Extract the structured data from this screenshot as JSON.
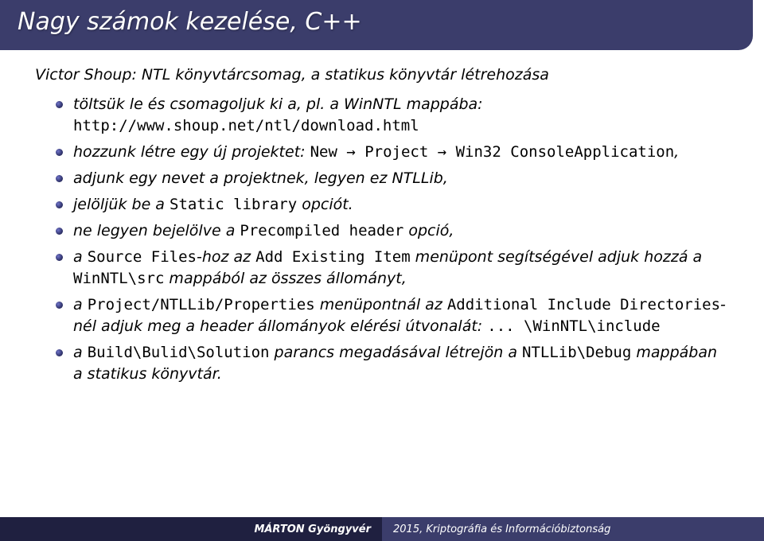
{
  "title": "Nagy számok kezelése, C++",
  "intro": "Victor Shoup: NTL könyvtárcsomag, a statikus könyvtár létrehozása",
  "items": {
    "b1_a": "töltsük le és csomagoljuk ki a, pl. a WinNTL mappába:",
    "b1_b": "http://www.shoup.net/ntl/download.html",
    "b2_a": "hozzunk létre egy új projektet: ",
    "b2_b": "New → Project → Win32 ConsoleApplication",
    "b2_c": ",",
    "b3": "adjunk egy nevet a projektnek, legyen ez NTLLib,",
    "b4_a": "jelöljük be a ",
    "b4_b": "Static library",
    "b4_c": " opciót.",
    "b5_a": "ne legyen bejelölve a ",
    "b5_b": "Precompiled header",
    "b5_c": " opció,",
    "b6_a": "a ",
    "b6_b": "Source Files",
    "b6_c": "-hoz az ",
    "b6_d": "Add Existing Item",
    "b6_e": " menüpont segítségével adjuk hozzá a ",
    "b6_f": "WinNTL\\src",
    "b6_g": " mappából az összes állományt,",
    "b7_a": "a ",
    "b7_b": "Project/NTLLib/Properties",
    "b7_c": " menüpontnál az ",
    "b7_d": "Additional Include Directories",
    "b7_e": "-nél adjuk meg a header állományok elérési útvonalát: ",
    "b7_f": "... \\WinNTL\\include",
    "b8_a": "a ",
    "b8_b": "Build\\Bulid\\Solution",
    "b8_c": " parancs megadásával létrejön a ",
    "b8_d": "NTLLib\\Debug",
    "b8_e": " mappában a statikus könyvtár."
  },
  "footer": {
    "author": "MÁRTON Gyöngyvér",
    "course": "2015, Kriptográfia és Információbiztonság"
  }
}
